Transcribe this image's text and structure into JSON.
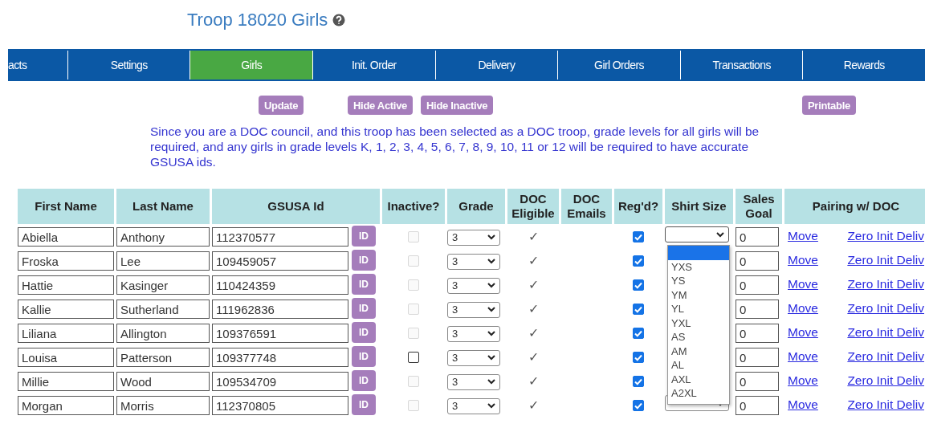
{
  "title": "Troop 18020 Girls",
  "tabs": [
    {
      "label": "acts",
      "selected": false
    },
    {
      "label": "Settings",
      "selected": false
    },
    {
      "label": "Girls",
      "selected": true
    },
    {
      "label": "Init. Order",
      "selected": false
    },
    {
      "label": "Delivery",
      "selected": false
    },
    {
      "label": "Girl Orders",
      "selected": false
    },
    {
      "label": "Transactions",
      "selected": false
    },
    {
      "label": "Rewards",
      "selected": false
    }
  ],
  "buttons": [
    "Update",
    "Hide Active",
    "Hide Inactive",
    "Printable"
  ],
  "notice": "Since you are a DOC council, and this troop has been selected as a DOC troop, grade levels for all girls will be required, and any girls in grade levels K, 1, 2, 3, 4, 5, 6, 7, 8, 9, 10, 11 or 12 will be required to have accurate GSUSA ids.",
  "table": {
    "columns": [
      "First Name",
      "Last Name",
      "GSUSA Id",
      "Inactive?",
      "Grade",
      "DOC Eligible",
      "DOC Emails",
      "Reg'd?",
      "Shirt Size",
      "Sales Goal",
      "Pairing w/ DOC"
    ],
    "rows": [
      {
        "first_name": "Abiella",
        "last_name": "Anthony",
        "gsusa_id": "112370577",
        "id_button": "ID",
        "inactive": {
          "checked": false,
          "disabled": true
        },
        "grade": "3",
        "doc_eligible": "✓",
        "regd": true,
        "shirt_size": {
          "expanded": true,
          "options": [
            "YXS",
            "YS",
            "YM",
            "YL",
            "YXL",
            "AS",
            "AM",
            "AL",
            "AXL",
            "A2XL"
          ]
        },
        "sales_goal": "0",
        "links": [
          "Move",
          "Zero Init Deliv"
        ]
      },
      {
        "first_name": "Froska",
        "last_name": "Lee",
        "gsusa_id": "109459057",
        "id_button": "ID",
        "inactive": {
          "checked": false,
          "disabled": true
        },
        "grade": "3",
        "doc_eligible": "✓",
        "regd": true,
        "sales_goal": "0",
        "links": [
          "Move",
          "Zero Init Deliv"
        ]
      },
      {
        "first_name": "Hattie",
        "last_name": "Kasinger",
        "gsusa_id": "110424359",
        "id_button": "ID",
        "inactive": {
          "checked": false,
          "disabled": true
        },
        "grade": "3",
        "doc_eligible": "✓",
        "regd": true,
        "sales_goal": "0",
        "links": [
          "Move",
          "Zero Init Deliv"
        ]
      },
      {
        "first_name": "Kallie",
        "last_name": "Sutherland",
        "gsusa_id": "111962836",
        "id_button": "ID",
        "inactive": {
          "checked": false,
          "disabled": true
        },
        "grade": "3",
        "doc_eligible": "✓",
        "regd": true,
        "sales_goal": "0",
        "links": [
          "Move",
          "Zero Init Deliv"
        ]
      },
      {
        "first_name": "Liliana",
        "last_name": "Allington",
        "gsusa_id": "109376591",
        "id_button": "ID",
        "inactive": {
          "checked": false,
          "disabled": true
        },
        "grade": "3",
        "doc_eligible": "✓",
        "regd": true,
        "sales_goal": "0",
        "links": [
          "Move",
          "Zero Init Deliv"
        ]
      },
      {
        "first_name": "Louisa",
        "last_name": "Patterson",
        "gsusa_id": "109377748",
        "id_button": "ID",
        "inactive": {
          "checked": false,
          "disabled": false
        },
        "grade": "3",
        "doc_eligible": "✓",
        "regd": true,
        "sales_goal": "0",
        "links": [
          "Move",
          "Zero Init Deliv"
        ]
      },
      {
        "first_name": "Millie",
        "last_name": "Wood",
        "gsusa_id": "109534709",
        "id_button": "ID",
        "inactive": {
          "checked": false,
          "disabled": true
        },
        "grade": "3",
        "doc_eligible": "✓",
        "regd": true,
        "sales_goal": "0",
        "links": [
          "Move",
          "Zero Init Deliv"
        ]
      },
      {
        "first_name": "Morgan",
        "last_name": "Morris",
        "gsusa_id": "112370805",
        "id_button": "ID",
        "inactive": {
          "checked": false,
          "disabled": true
        },
        "grade": "3",
        "doc_eligible": "✓",
        "regd": true,
        "shirt_size": {
          "expanded": false
        },
        "sales_goal": "0",
        "links": [
          "Move",
          "Zero Init Deliv"
        ]
      }
    ]
  }
}
